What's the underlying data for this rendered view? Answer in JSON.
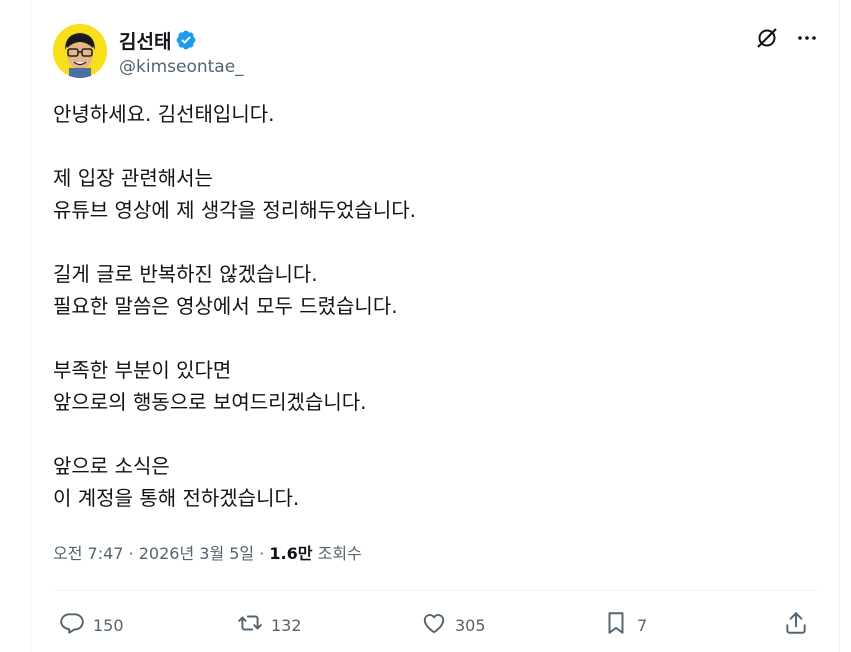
{
  "author": {
    "display_name": "김선태",
    "handle": "@kimseontae_"
  },
  "tweet": {
    "paragraphs": [
      [
        "안녕하세요. 김선태입니다."
      ],
      [
        "제 입장 관련해서는",
        "유튜브 영상에 제 생각을 정리해두었습니다."
      ],
      [
        "길게 글로 반복하진 않겠습니다.",
        "필요한 말씀은 영상에서 모두 드렸습니다."
      ],
      [
        "부족한 부분이 있다면",
        "앞으로의 행동으로 보여드리겠습니다."
      ],
      [
        "앞으로 소식은",
        "이 계정을 통해 전하겠습니다."
      ]
    ]
  },
  "meta": {
    "time": "오전 7:47",
    "separator": " · ",
    "date": "2026년 3월 5일",
    "views_count": "1.6만",
    "views_label": "조회수"
  },
  "actions": {
    "reply_count": "150",
    "retweet_count": "132",
    "like_count": "305",
    "bookmark_count": "7"
  },
  "colors": {
    "verified": "#1d9bf0",
    "secondary_text": "#536471",
    "avatar_bg": "#f7e01a"
  },
  "icons": [
    "verified-badge-icon",
    "grok-icon",
    "more-icon",
    "reply-icon",
    "retweet-icon",
    "like-icon",
    "bookmark-icon",
    "share-icon"
  ]
}
